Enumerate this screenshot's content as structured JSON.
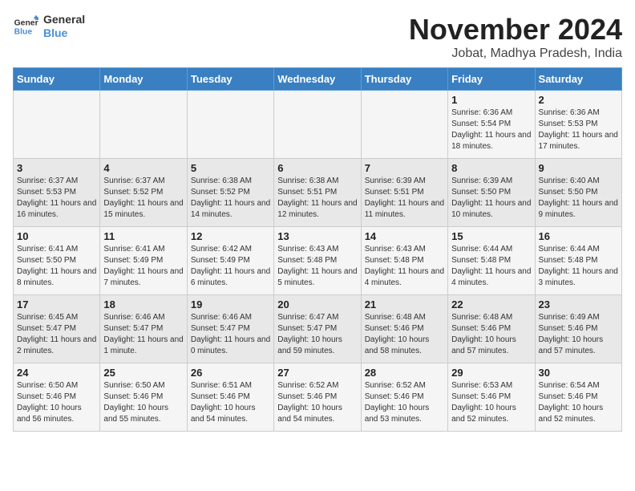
{
  "logo": {
    "line1": "General",
    "line2": "Blue"
  },
  "title": "November 2024",
  "location": "Jobat, Madhya Pradesh, India",
  "headers": [
    "Sunday",
    "Monday",
    "Tuesday",
    "Wednesday",
    "Thursday",
    "Friday",
    "Saturday"
  ],
  "weeks": [
    [
      {
        "day": "",
        "info": ""
      },
      {
        "day": "",
        "info": ""
      },
      {
        "day": "",
        "info": ""
      },
      {
        "day": "",
        "info": ""
      },
      {
        "day": "",
        "info": ""
      },
      {
        "day": "1",
        "info": "Sunrise: 6:36 AM\nSunset: 5:54 PM\nDaylight: 11 hours and 18 minutes."
      },
      {
        "day": "2",
        "info": "Sunrise: 6:36 AM\nSunset: 5:53 PM\nDaylight: 11 hours and 17 minutes."
      }
    ],
    [
      {
        "day": "3",
        "info": "Sunrise: 6:37 AM\nSunset: 5:53 PM\nDaylight: 11 hours and 16 minutes."
      },
      {
        "day": "4",
        "info": "Sunrise: 6:37 AM\nSunset: 5:52 PM\nDaylight: 11 hours and 15 minutes."
      },
      {
        "day": "5",
        "info": "Sunrise: 6:38 AM\nSunset: 5:52 PM\nDaylight: 11 hours and 14 minutes."
      },
      {
        "day": "6",
        "info": "Sunrise: 6:38 AM\nSunset: 5:51 PM\nDaylight: 11 hours and 12 minutes."
      },
      {
        "day": "7",
        "info": "Sunrise: 6:39 AM\nSunset: 5:51 PM\nDaylight: 11 hours and 11 minutes."
      },
      {
        "day": "8",
        "info": "Sunrise: 6:39 AM\nSunset: 5:50 PM\nDaylight: 11 hours and 10 minutes."
      },
      {
        "day": "9",
        "info": "Sunrise: 6:40 AM\nSunset: 5:50 PM\nDaylight: 11 hours and 9 minutes."
      }
    ],
    [
      {
        "day": "10",
        "info": "Sunrise: 6:41 AM\nSunset: 5:50 PM\nDaylight: 11 hours and 8 minutes."
      },
      {
        "day": "11",
        "info": "Sunrise: 6:41 AM\nSunset: 5:49 PM\nDaylight: 11 hours and 7 minutes."
      },
      {
        "day": "12",
        "info": "Sunrise: 6:42 AM\nSunset: 5:49 PM\nDaylight: 11 hours and 6 minutes."
      },
      {
        "day": "13",
        "info": "Sunrise: 6:43 AM\nSunset: 5:48 PM\nDaylight: 11 hours and 5 minutes."
      },
      {
        "day": "14",
        "info": "Sunrise: 6:43 AM\nSunset: 5:48 PM\nDaylight: 11 hours and 4 minutes."
      },
      {
        "day": "15",
        "info": "Sunrise: 6:44 AM\nSunset: 5:48 PM\nDaylight: 11 hours and 4 minutes."
      },
      {
        "day": "16",
        "info": "Sunrise: 6:44 AM\nSunset: 5:48 PM\nDaylight: 11 hours and 3 minutes."
      }
    ],
    [
      {
        "day": "17",
        "info": "Sunrise: 6:45 AM\nSunset: 5:47 PM\nDaylight: 11 hours and 2 minutes."
      },
      {
        "day": "18",
        "info": "Sunrise: 6:46 AM\nSunset: 5:47 PM\nDaylight: 11 hours and 1 minute."
      },
      {
        "day": "19",
        "info": "Sunrise: 6:46 AM\nSunset: 5:47 PM\nDaylight: 11 hours and 0 minutes."
      },
      {
        "day": "20",
        "info": "Sunrise: 6:47 AM\nSunset: 5:47 PM\nDaylight: 10 hours and 59 minutes."
      },
      {
        "day": "21",
        "info": "Sunrise: 6:48 AM\nSunset: 5:46 PM\nDaylight: 10 hours and 58 minutes."
      },
      {
        "day": "22",
        "info": "Sunrise: 6:48 AM\nSunset: 5:46 PM\nDaylight: 10 hours and 57 minutes."
      },
      {
        "day": "23",
        "info": "Sunrise: 6:49 AM\nSunset: 5:46 PM\nDaylight: 10 hours and 57 minutes."
      }
    ],
    [
      {
        "day": "24",
        "info": "Sunrise: 6:50 AM\nSunset: 5:46 PM\nDaylight: 10 hours and 56 minutes."
      },
      {
        "day": "25",
        "info": "Sunrise: 6:50 AM\nSunset: 5:46 PM\nDaylight: 10 hours and 55 minutes."
      },
      {
        "day": "26",
        "info": "Sunrise: 6:51 AM\nSunset: 5:46 PM\nDaylight: 10 hours and 54 minutes."
      },
      {
        "day": "27",
        "info": "Sunrise: 6:52 AM\nSunset: 5:46 PM\nDaylight: 10 hours and 54 minutes."
      },
      {
        "day": "28",
        "info": "Sunrise: 6:52 AM\nSunset: 5:46 PM\nDaylight: 10 hours and 53 minutes."
      },
      {
        "day": "29",
        "info": "Sunrise: 6:53 AM\nSunset: 5:46 PM\nDaylight: 10 hours and 52 minutes."
      },
      {
        "day": "30",
        "info": "Sunrise: 6:54 AM\nSunset: 5:46 PM\nDaylight: 10 hours and 52 minutes."
      }
    ]
  ]
}
